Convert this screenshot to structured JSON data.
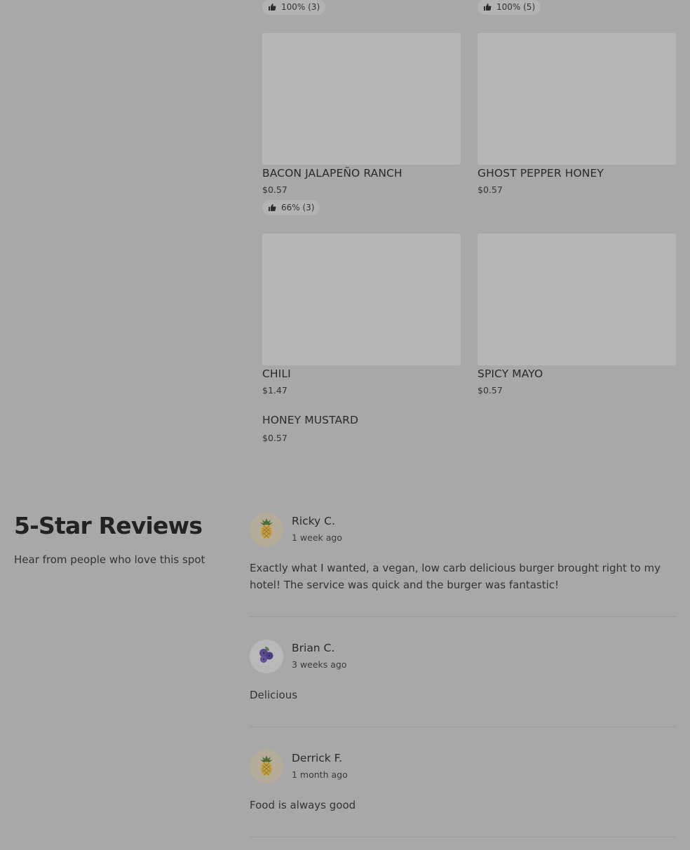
{
  "menu_items": [
    {
      "name": "",
      "price": "",
      "rating": "100% (3)"
    },
    {
      "name": "",
      "price": "",
      "rating": "100% (5)"
    },
    {
      "name": "BACON JALAPEÑO RANCH",
      "price": "$0.57",
      "rating": "66% (3)"
    },
    {
      "name": "GHOST PEPPER HONEY",
      "price": "$0.57",
      "rating": ""
    },
    {
      "name": "CHILI",
      "price": "$1.47",
      "rating": ""
    },
    {
      "name": "SPICY MAYO",
      "price": "$0.57",
      "rating": ""
    },
    {
      "name": "HONEY MUSTARD",
      "price": "$0.57",
      "rating": ""
    }
  ],
  "icons": {
    "thumbs_up": "thumbs-up-icon",
    "pineapple": "pineapple-icon",
    "blueberries": "blueberries-icon"
  },
  "reviews": {
    "title": "5-Star Reviews",
    "subtitle": "Hear from people who love this spot",
    "items": [
      {
        "author": "Ricky C.",
        "time": "1 week ago",
        "avatar_icon": "pineapple-icon",
        "text": "Exactly what I wanted, a vegan, low carb delicious burger brought right to my hotel! The service was quick and the burger was fantastic!"
      },
      {
        "author": "Brian C.",
        "time": "3 weeks ago",
        "avatar_icon": "blueberries-icon",
        "text": "Delicious"
      },
      {
        "author": "Derrick F.",
        "time": "1 month ago",
        "avatar_icon": "pineapple-icon",
        "text": "Food is always good"
      }
    ]
  },
  "colors": {
    "overlay_background": "#a8a8a8",
    "image_placeholder": "#b7b7b7",
    "badge_background": "#b3b3b3"
  }
}
